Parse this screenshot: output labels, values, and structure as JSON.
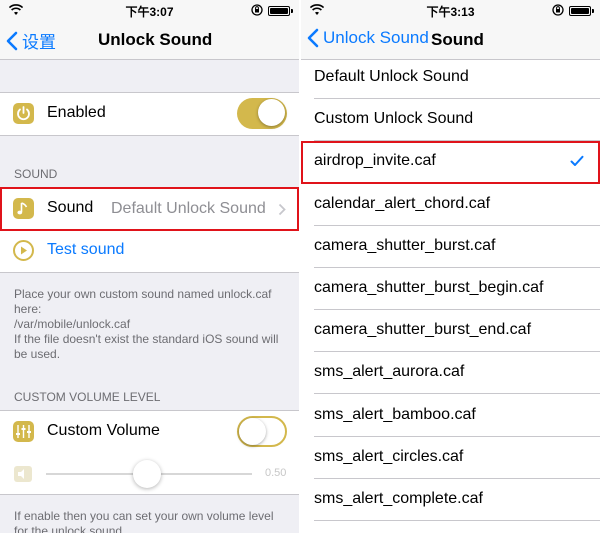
{
  "left": {
    "status_time": "下午3:07",
    "nav": {
      "back_label": "设置",
      "title": "Unlock Sound"
    },
    "enabled_label": "Enabled",
    "section_sound_header": "SOUND",
    "sound_label": "Sound",
    "sound_value": "Default Unlock Sound",
    "test_sound_label": "Test sound",
    "info_footer": "Place your own custom sound named unlock.caf here:\n/var/mobile/unlock.caf\nIf the file doesn't exist the standard iOS sound will be used.",
    "section_volume_header": "CUSTOM VOLUME LEVEL",
    "custom_volume_label": "Custom Volume",
    "volume_value": "0.50",
    "volume_footer": "If enable then you can set your own volume level for the unlock sound",
    "enabled_on": true,
    "custom_volume_on": false,
    "volume_level": 0.5
  },
  "right": {
    "status_time": "下午3:13",
    "nav": {
      "back_label": "Unlock Sound",
      "title": "Sound"
    },
    "items": [
      "Default Unlock Sound",
      "Custom Unlock Sound",
      "airdrop_invite.caf",
      "calendar_alert_chord.caf",
      "camera_shutter_burst.caf",
      "camera_shutter_burst_begin.caf",
      "camera_shutter_burst_end.caf",
      "sms_alert_aurora.caf",
      "sms_alert_bamboo.caf",
      "sms_alert_circles.caf",
      "sms_alert_complete.caf"
    ],
    "selected_item": "airdrop_invite.caf"
  },
  "colors": {
    "accent": "#0a7aff",
    "icon_gold": "#d3b84c",
    "highlight_red": "#e0131a"
  }
}
